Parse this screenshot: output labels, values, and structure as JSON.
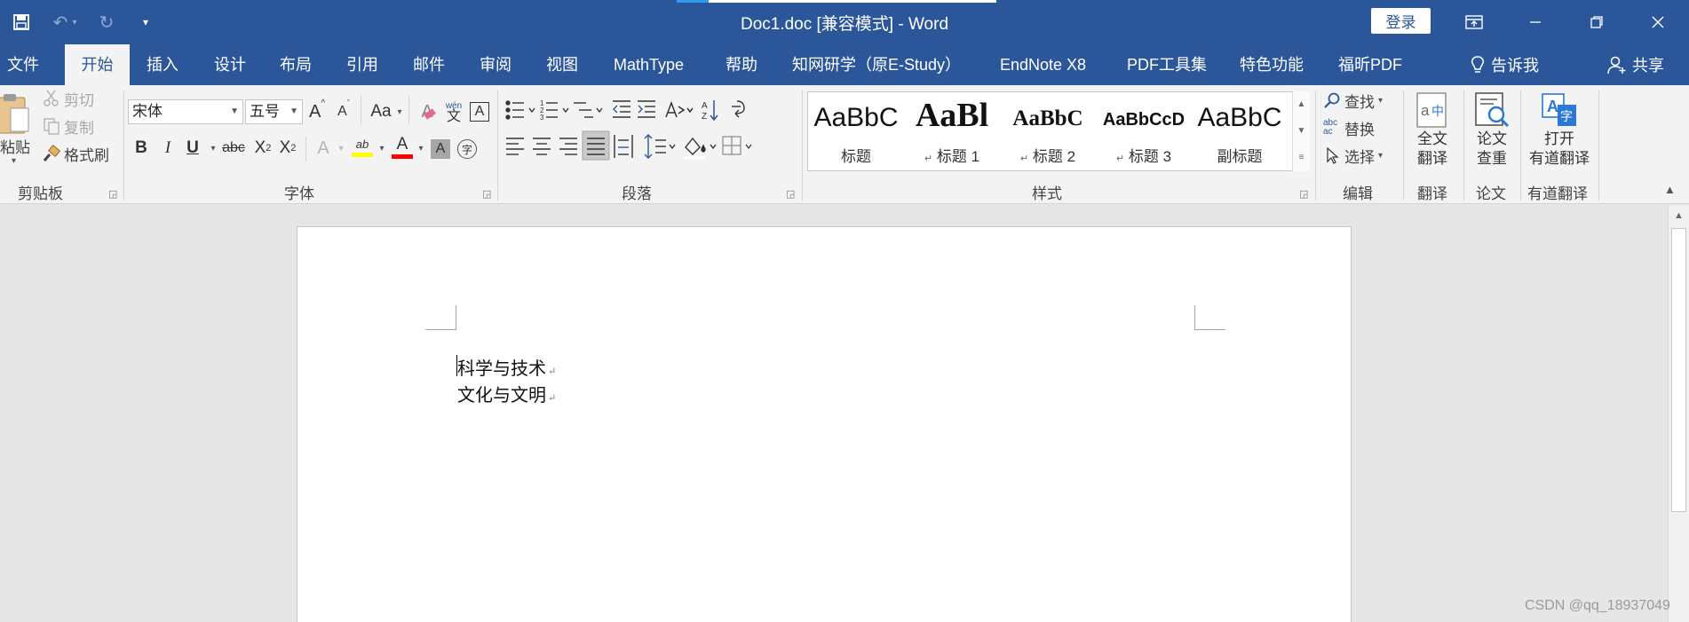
{
  "titlebar": {
    "title": "Doc1.doc [兼容模式]  -  Word",
    "login": "登录"
  },
  "tabs": [
    {
      "label": "文件"
    },
    {
      "label": "开始",
      "active": true
    },
    {
      "label": "插入"
    },
    {
      "label": "设计"
    },
    {
      "label": "布局"
    },
    {
      "label": "引用"
    },
    {
      "label": "邮件"
    },
    {
      "label": "审阅"
    },
    {
      "label": "视图"
    },
    {
      "label": "MathType"
    },
    {
      "label": "帮助"
    },
    {
      "label": "知网研学（原E-Study）"
    },
    {
      "label": "EndNote X8"
    },
    {
      "label": "PDF工具集"
    },
    {
      "label": "特色功能"
    },
    {
      "label": "福昕PDF"
    }
  ],
  "tellme": "告诉我",
  "share": "共享",
  "clipboard": {
    "paste": "粘贴",
    "cut": "剪切",
    "copy": "复制",
    "format_painter": "格式刷",
    "group": "剪贴板"
  },
  "font": {
    "name": "宋体",
    "size": "五号",
    "group": "字体",
    "bold": "B",
    "italic": "I",
    "underline": "U",
    "strike": "abc",
    "sub": "X",
    "sub_mark": "2",
    "sup": "X",
    "sup_mark": "2",
    "aa": "Aa",
    "wen": "wén",
    "wen_char": "文",
    "boxed": "A",
    "clear_a": "A",
    "highlight": "ab",
    "color_a": "A",
    "shade_a": "A",
    "circle_char": "字",
    "grow": "A",
    "shrink": "A"
  },
  "paragraph": {
    "group": "段落",
    "sort": "A↓"
  },
  "styles": {
    "group": "样式",
    "items": [
      {
        "preview": "AaBbC",
        "name": "标题"
      },
      {
        "preview": "AaBl",
        "name": "标题 1"
      },
      {
        "preview": "AaBbC",
        "name": "标题 2"
      },
      {
        "preview": "AaBbCcD",
        "name": "标题 3"
      },
      {
        "preview": "AaBbC",
        "name": "副标题"
      }
    ]
  },
  "editing": {
    "find": "查找",
    "replace": "替换",
    "select": "选择",
    "group": "编辑",
    "abc": "abc",
    "ac": "ac"
  },
  "translate": {
    "label1": "全文",
    "label2": "翻译",
    "group": "翻译",
    "icon_a": "a",
    "icon_zh": "中"
  },
  "paper": {
    "label1": "论文",
    "label2": "查重",
    "group": "论文"
  },
  "youdao": {
    "label1": "打开",
    "label2": "有道翻译",
    "group": "有道翻译",
    "icon_a": "A",
    "icon_zi": "字"
  },
  "document": {
    "lines": [
      "科学与技术",
      "文化与文明"
    ],
    "para_mark": "↵"
  },
  "watermark": "CSDN @qq_18937049"
}
